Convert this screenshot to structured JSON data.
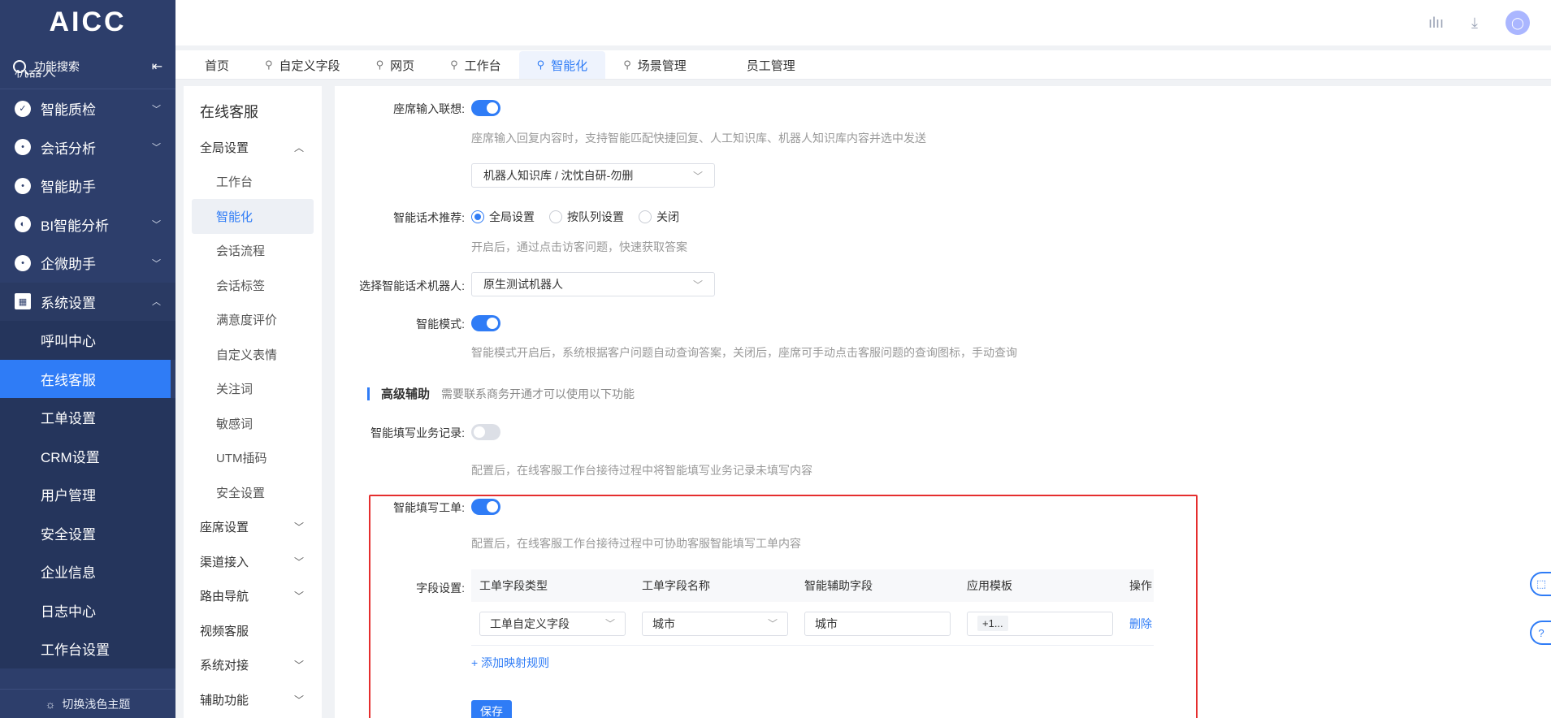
{
  "app": {
    "logo": "AICC"
  },
  "sidebar": {
    "search_label": "功能搜索",
    "partial_item": "机器人",
    "items": [
      {
        "label": "智能质检"
      },
      {
        "label": "会话分析"
      },
      {
        "label": "智能助手"
      },
      {
        "label": "BI智能分析"
      },
      {
        "label": "企微助手"
      },
      {
        "label": "系统设置"
      }
    ],
    "sub_items": [
      {
        "label": "呼叫中心"
      },
      {
        "label": "在线客服"
      },
      {
        "label": "工单设置"
      },
      {
        "label": "CRM设置"
      },
      {
        "label": "用户管理"
      },
      {
        "label": "安全设置"
      },
      {
        "label": "企业信息"
      },
      {
        "label": "日志中心"
      },
      {
        "label": "工作台设置"
      }
    ],
    "theme_toggle": "切换浅色主题"
  },
  "tabs": [
    {
      "label": "首页"
    },
    {
      "label": "自定义字段"
    },
    {
      "label": "网页"
    },
    {
      "label": "工作台"
    },
    {
      "label": "智能化"
    },
    {
      "label": "场景管理"
    },
    {
      "label": "员工管理"
    }
  ],
  "submenu": {
    "title": "在线客服",
    "global_settings": "全局设置",
    "global_items": [
      {
        "label": "工作台"
      },
      {
        "label": "智能化"
      },
      {
        "label": "会话流程"
      },
      {
        "label": "会话标签"
      },
      {
        "label": "满意度评价"
      },
      {
        "label": "自定义表情"
      },
      {
        "label": "关注词"
      },
      {
        "label": "敏感词"
      },
      {
        "label": "UTM插码"
      },
      {
        "label": "安全设置"
      }
    ],
    "groups": [
      {
        "label": "座席设置"
      },
      {
        "label": "渠道接入"
      },
      {
        "label": "路由导航"
      },
      {
        "label": "视频客服"
      },
      {
        "label": "系统对接"
      },
      {
        "label": "辅助功能"
      }
    ]
  },
  "main": {
    "seat_input": {
      "label": "座席输入联想:",
      "hint": "座席输入回复内容时，支持智能匹配快捷回复、人工知识库、机器人知识库内容并选中发送",
      "select_value": "机器人知识库 / 沈忱自研-勿删"
    },
    "smart_recommend": {
      "label": "智能话术推荐:",
      "options": [
        {
          "label": "全局设置"
        },
        {
          "label": "按队列设置"
        },
        {
          "label": "关闭"
        }
      ],
      "hint": "开启后，通过点击访客问题，快速获取答案"
    },
    "robot_select": {
      "label": "选择智能话术机器人:",
      "value": "原生测试机器人"
    },
    "smart_mode": {
      "label": "智能模式:",
      "hint": "智能模式开启后，系统根据客户问题自动查询答案，关闭后，座席可手动点击客服问题的查询图标，手动查询"
    },
    "advanced": {
      "title": "高级辅助",
      "sub": "需要联系商务开通才可以使用以下功能"
    },
    "fill_record": {
      "label": "智能填写业务记录:",
      "hint": "配置后，在线客服工作台接待过程中将智能填写业务记录未填写内容"
    },
    "fill_ticket": {
      "label": "智能填写工单:",
      "hint": "配置后，在线客服工作台接待过程中可协助客服智能填写工单内容"
    },
    "field_settings": {
      "label": "字段设置:",
      "headers": [
        "工单字段类型",
        "工单字段名称",
        "智能辅助字段",
        "应用模板",
        "操作"
      ],
      "row": {
        "type": "工单自定义字段",
        "name": "城市",
        "assist": "城市",
        "template": "+1...",
        "action": "删除"
      },
      "add_rule": "添加映射规则"
    },
    "save": "保存"
  }
}
